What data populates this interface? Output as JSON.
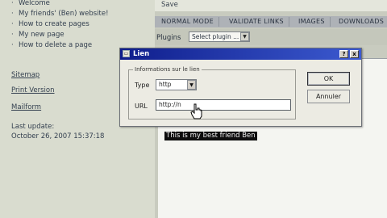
{
  "sidebar": {
    "items": [
      {
        "label": "Welcome"
      },
      {
        "label": "My friends' (Ben) website!"
      },
      {
        "label": "How to create pages"
      },
      {
        "label": "My new page"
      },
      {
        "label": "How to delete a page"
      }
    ],
    "links": [
      "Sitemap",
      "Print Version",
      "Mailform"
    ],
    "last_update_label": "Last update:",
    "last_update_value": "October 26, 2007 15:37:18"
  },
  "editor": {
    "save_label": "Save",
    "modes": [
      "NORMAL MODE",
      "VALIDATE LINKS",
      "IMAGES",
      "DOWNLOADS"
    ],
    "plugins_label": "Plugins",
    "plugin_select_value": "Select plugin ...",
    "selected_text": "This is my best friend Ben"
  },
  "dialog": {
    "title": "Lien",
    "help_button": "?",
    "close_button": "x",
    "legend": "Informations sur le lien",
    "type_label": "Type",
    "type_value": "http",
    "url_label": "URL",
    "url_value": "http://n",
    "ok_label": "OK",
    "cancel_label": "Annuler"
  },
  "colors": {
    "titlebar": "#0f1e8c",
    "selection_bg": "#0d0d0d",
    "accent_red": "#b52a24"
  }
}
